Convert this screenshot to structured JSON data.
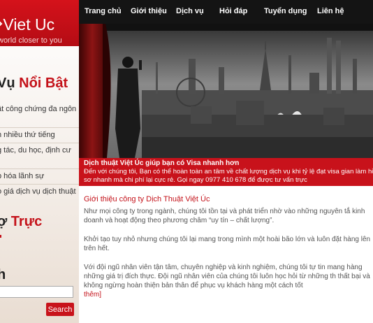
{
  "brand": {
    "name": "Viet Uc",
    "tagline": "world closer to you"
  },
  "nav": {
    "items": [
      "Trang chủ",
      "Giới thiệu",
      "Dịch vụ",
      "Hỏi đáp",
      "Tuyển dụng",
      "Liên hệ"
    ]
  },
  "sidebar": {
    "news_heading_a": "Vụ ",
    "news_heading_b": "Nổi Bật",
    "links": [
      "ật công chứng đa ngôn",
      "n nhiều thứ tiếng",
      "g tác, du học, định cư",
      "p hóa lãnh sự",
      "o giá dịch vụ dịch thuật"
    ],
    "support_heading_a": "ợ ",
    "support_heading_b": "Trực",
    "search_heading": "h",
    "search_value": "",
    "search_button": "Search"
  },
  "banner": {
    "caption_title": "Dịch thuật Việt Úc giúp bạn có Visa nhanh hơn",
    "caption_text": "Đến với chúng tôi, Bạn có thể hoàn toàn an tâm về chất lượng dịch vụ khi tỷ lệ đạt visa gian làm hồ sơ nhanh mà chi phí lại cực rẻ. Gọi ngay 0977 410 678 để được tư vấn trực"
  },
  "intro": {
    "title": "Giới thiệu công ty Dịch Thuật Việt Úc",
    "paragraphs": [
      "Như mọi công ty trong ngành, chúng tôi tồn tại và phát triển nhờ vào những nguyên tắ kinh doanh và hoạt động theo phương châm “uy tín – chất lượng”.",
      "Khởi tạo tuy nhỏ nhưng chúng tôi lại mang trong mình một hoài bão lớn và luôn đặt hàng lên trên hết.",
      "Với đội ngũ nhân viên tận tâm, chuyên nghiệp và kinh nghiệm, chúng tôi tự tin mang hàng những giá trị đích thực. Đội ngũ nhân viên của chúng tôi luôn học hỏi từ những th thất bại và không ngừng hoàn thiện bản thân để phục vụ khách hàng một cách tốt"
    ],
    "more_link": "thêm]"
  }
}
